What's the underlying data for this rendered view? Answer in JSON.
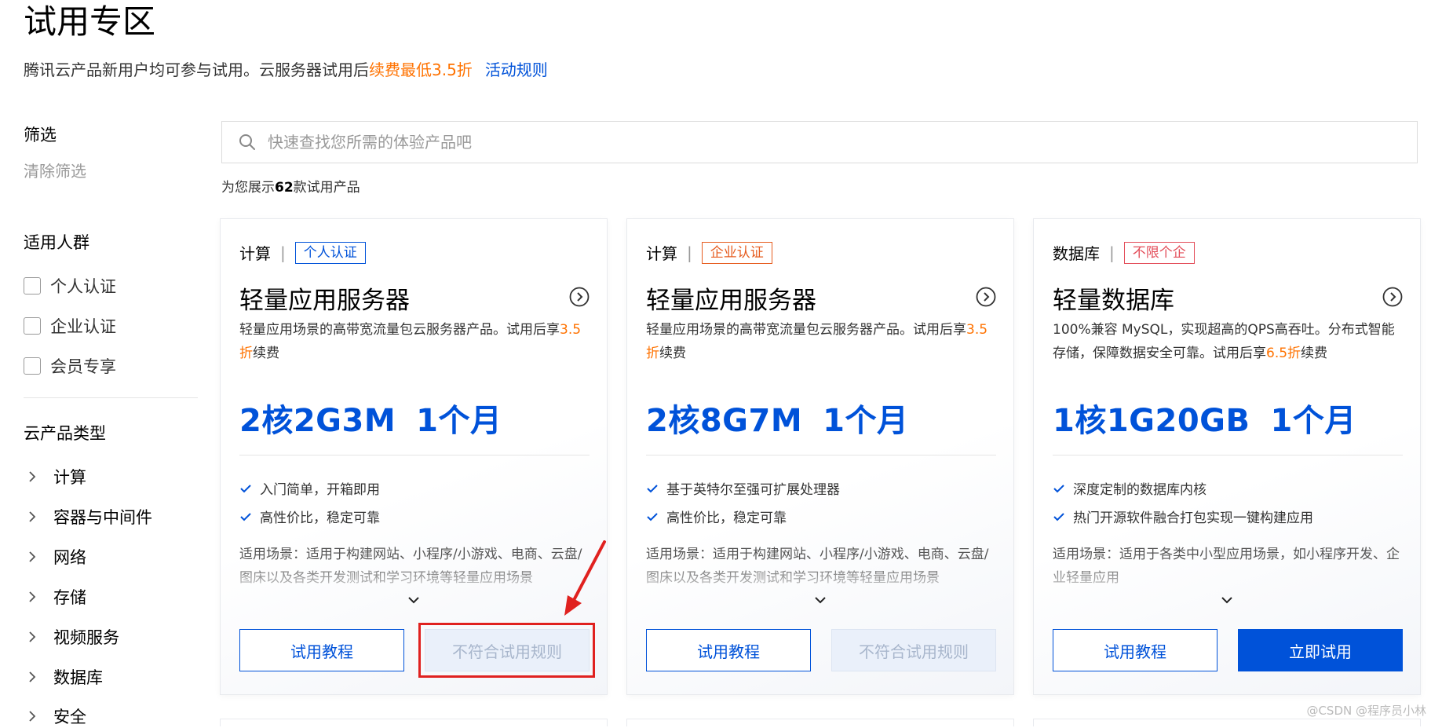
{
  "header": {
    "title": "试用专区",
    "subtitle_prefix": "腾讯云产品新用户均可参与试用。云服务器试用后",
    "subtitle_highlight": "续费最低3.5折",
    "rules_link": "活动规则"
  },
  "sidebar": {
    "filter_title": "筛选",
    "clear_filter": "清除筛选",
    "audience_title": "适用人群",
    "audience_options": [
      "个人认证",
      "企业认证",
      "会员专享"
    ],
    "category_title": "云产品类型",
    "categories": [
      "计算",
      "容器与中间件",
      "网络",
      "存储",
      "视频服务",
      "数据库",
      "安全"
    ]
  },
  "search": {
    "placeholder": "快速查找您所需的体验产品吧",
    "value": ""
  },
  "count": {
    "prefix": "为您展示",
    "number": "62",
    "suffix": "款试用产品"
  },
  "cards": [
    {
      "category": "计算",
      "badge": "个人认证",
      "name": "轻量应用服务器",
      "desc_main": "轻量应用场景的高带宽流量包云服务器产品。试用后享",
      "desc_highlight": "3.5折",
      "desc_end": "续费",
      "spec": "2核2G3M",
      "duration": "1个月",
      "features": [
        "入门简单，开箱即用",
        "高性价比，稳定可靠"
      ],
      "scene": "适用场景：适用于构建网站、小程序/小游戏、电商、云盘/图床以及各类开发测试和学习环境等轻量应用场景",
      "tutorial_button": "试用教程",
      "action_button": "不符合试用规则"
    },
    {
      "category": "计算",
      "badge": "企业认证",
      "name": "轻量应用服务器",
      "desc_main": "轻量应用场景的高带宽流量包云服务器产品。试用后享",
      "desc_highlight": "3.5折",
      "desc_end": "续费",
      "spec": "2核8G7M",
      "duration": "1个月",
      "features": [
        "基于英特尔至强可扩展处理器",
        "高性价比，稳定可靠"
      ],
      "scene": "适用场景：适用于构建网站、小程序/小游戏、电商、云盘/图床以及各类开发测试和学习环境等轻量应用场景",
      "tutorial_button": "试用教程",
      "action_button": "不符合试用规则"
    },
    {
      "category": "数据库",
      "badge": "不限个企",
      "name": "轻量数据库",
      "desc_main": "100%兼容 MySQL，实现超高的QPS高吞吐。分布式智能存储，保障数据安全可靠。试用后享",
      "desc_highlight": "6.5折",
      "desc_end": "续费",
      "spec": "1核1G20GB",
      "duration": "1个月",
      "features": [
        "深度定制的数据库内核",
        "热门开源软件融合打包实现一键构建应用"
      ],
      "scene": "适用场景：适用于各类中小型应用场景，如小程序开发、企业轻量应用",
      "tutorial_button": "试用教程",
      "action_button": "立即试用"
    }
  ],
  "watermark": "@CSDN @程序员小林",
  "colors": {
    "brand_blue": "#0052d9",
    "highlight_orange": "#ff7200",
    "annotation_red": "#e0211f",
    "disabled_text": "#a8b6cc"
  }
}
